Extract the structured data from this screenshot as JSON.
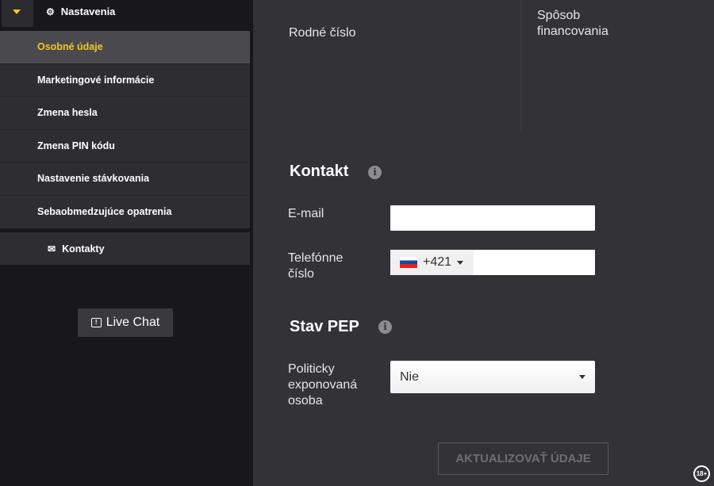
{
  "sidebar": {
    "section_title": "Nastavenia",
    "items": [
      {
        "label": "Osobné údaje",
        "active": true
      },
      {
        "label": "Marketingové informácie"
      },
      {
        "label": "Zmena hesla"
      },
      {
        "label": "Zmena PIN kódu"
      },
      {
        "label": "Nastavenie stávkovania"
      },
      {
        "label": "Sebaobmedzujúce opatrenia"
      }
    ],
    "contacts_label": "Kontakty",
    "live_chat_label": "Live Chat"
  },
  "main": {
    "birth_number_label": "Rodné číslo",
    "funding_label": "Spôsob financovania",
    "contact_title": "Kontakt",
    "email_label": "E-mail",
    "email_value": "",
    "phone_label": "Telefónne číslo",
    "phone_country_code": "+421",
    "phone_value": "",
    "pep_title": "Stav PEP",
    "pep_label": "Politicky exponovaná osoba",
    "pep_value": "Nie",
    "update_button": "AKTUALIZOVAŤ ÚDAJE",
    "age_badge": "18+"
  },
  "colors": {
    "accent": "#f3c623",
    "background": "#333237",
    "sidebar": "#18171b"
  }
}
